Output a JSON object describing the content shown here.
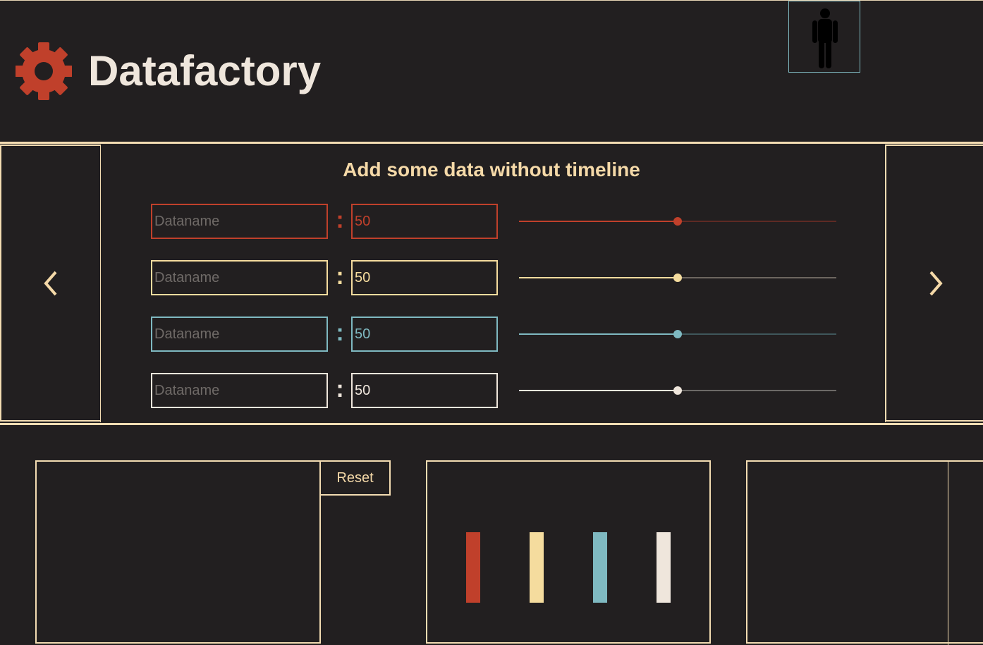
{
  "app": {
    "title": "Datafactory",
    "logo_icon": "gear-icon",
    "user_icon": "person-icon"
  },
  "colors": {
    "background": "#221f20",
    "accent_border": "#f3dcb2",
    "title_text": "#efe6dc",
    "red": "#c0402b",
    "yellow": "#f5dc9e",
    "teal": "#7fb9c1",
    "white": "#efe6dc"
  },
  "carousel": {
    "prev_icon": "chevron-left-icon",
    "next_icon": "chevron-right-icon",
    "title": "Add some data without timeline"
  },
  "rows": [
    {
      "name_placeholder": "Dataname",
      "value": "50",
      "slider_fraction": 0.5,
      "color": "#c0402b",
      "track": "#5e2a24",
      "value_text": "#c0402b"
    },
    {
      "name_placeholder": "Dataname",
      "value": "50",
      "slider_fraction": 0.5,
      "color": "#f5dc9e",
      "track": "#6d6660",
      "value_text": "#f5dc9e"
    },
    {
      "name_placeholder": "Dataname",
      "value": "50",
      "slider_fraction": 0.5,
      "color": "#7fb9c1",
      "track": "#3f575b",
      "value_text": "#7fb9c1"
    },
    {
      "name_placeholder": "Dataname",
      "value": "50",
      "slider_fraction": 0.5,
      "color": "#efe6dc",
      "track": "#6d6a67",
      "value_text": "#efe6dc"
    }
  ],
  "controls": {
    "reset_label": "Reset"
  },
  "chart_data": {
    "type": "bar",
    "categories": [
      "",
      "",
      "",
      ""
    ],
    "values": [
      50,
      50,
      50,
      50
    ],
    "colors": [
      "#c0402b",
      "#f5dc9e",
      "#7fb9c1",
      "#efe6dc"
    ]
  }
}
